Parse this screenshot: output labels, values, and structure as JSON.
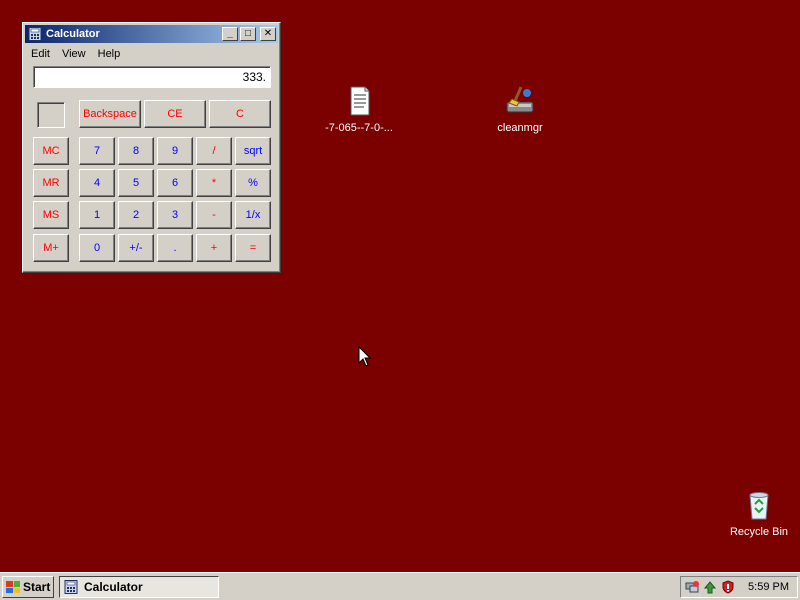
{
  "desktop": {
    "icons": [
      {
        "label": "-7-065--7-0-...",
        "icon": "text-document-icon"
      },
      {
        "label": "cleanmgr",
        "icon": "disk-cleanup-icon"
      },
      {
        "label": "Recycle Bin",
        "icon": "recycle-bin-icon"
      }
    ]
  },
  "calculator": {
    "title": "Calculator",
    "window_controls": {
      "minimize": "_",
      "maximize": "□",
      "close": "✕"
    },
    "menu": [
      "Edit",
      "View",
      "Help"
    ],
    "display_value": "333.",
    "buttons": {
      "backspace": "Backspace",
      "ce": "CE",
      "c": "C",
      "mc": "MC",
      "mr": "MR",
      "ms": "MS",
      "mplus": "M+",
      "d7": "7",
      "d8": "8",
      "d9": "9",
      "div": "/",
      "sqrt": "sqrt",
      "d4": "4",
      "d5": "5",
      "d6": "6",
      "mul": "*",
      "pct": "%",
      "d1": "1",
      "d2": "2",
      "d3": "3",
      "sub": "-",
      "inv": "1/x",
      "d0": "0",
      "sign": "+/-",
      "dot": ".",
      "add": "+",
      "eq": "="
    }
  },
  "taskbar": {
    "start_label": "Start",
    "task_label": "Calculator",
    "clock": "5:59 PM"
  },
  "colors": {
    "desktop_bg": "#7b0000",
    "face": "#d4d0c8",
    "title_start": "#0a246a",
    "title_end": "#a6caf0",
    "red_key": "#ff0000",
    "blue_key": "#0000ff"
  }
}
